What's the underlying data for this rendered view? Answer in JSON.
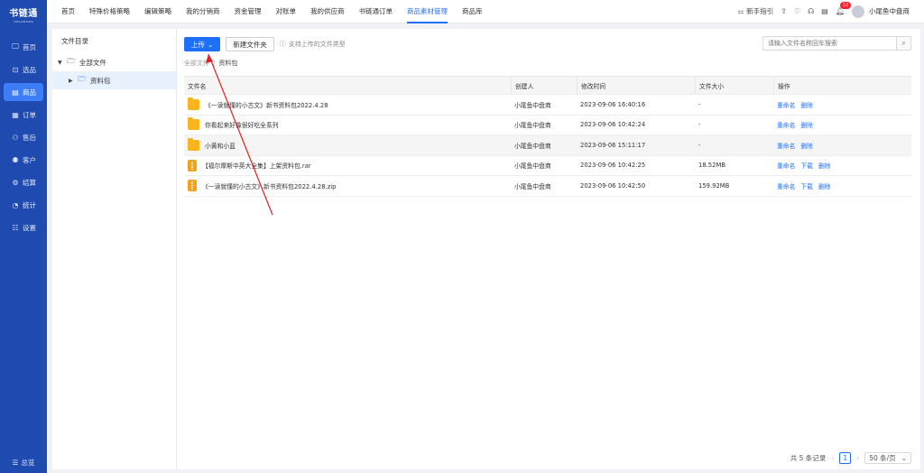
{
  "app": {
    "logo_text": "书链通",
    "logo_sub": "SHULIANTONG"
  },
  "sidebar": {
    "items": [
      {
        "label": "首页",
        "icon": "monitor-icon"
      },
      {
        "label": "选品",
        "icon": "select-icon"
      },
      {
        "label": "商品",
        "icon": "goods-icon",
        "active": true
      },
      {
        "label": "订单",
        "icon": "order-icon"
      },
      {
        "label": "售后",
        "icon": "aftersale-icon"
      },
      {
        "label": "客户",
        "icon": "customer-icon"
      },
      {
        "label": "结算",
        "icon": "settle-icon"
      },
      {
        "label": "统计",
        "icon": "stats-icon"
      },
      {
        "label": "设置",
        "icon": "settings-icon"
      }
    ],
    "collapse_label": "总览"
  },
  "topnav": {
    "tabs": [
      "首页",
      "特殊价格策略",
      "编辑策略",
      "我的分销商",
      "资金管理",
      "对账单",
      "我的供应商",
      "书链通订单",
      "商品素材管理",
      "商品库"
    ],
    "active_tab": "商品素材管理",
    "guide_label": "新手指引",
    "badge_count": "10",
    "user_name": "小尾鱼中盘商"
  },
  "directory": {
    "title": "文件目录",
    "root_label": "全部文件",
    "child_label": "资料包"
  },
  "toolbar": {
    "upload_label": "上传",
    "new_folder_label": "新建文件夹",
    "supported_types_label": "支持上传的文件类型",
    "search_placeholder": "请输入文件名称回车搜索"
  },
  "breadcrumb": {
    "root": "全部文件",
    "separator": "/",
    "current": "资料包"
  },
  "table": {
    "headers": {
      "name": "文件名",
      "creator": "创建人",
      "modified": "修改时间",
      "size": "文件大小",
      "ops": "操作"
    },
    "rows": [
      {
        "type": "folder",
        "name": "《一读就懂的小古文》新书资料包2022.4.28",
        "creator": "小尾鱼中盘商",
        "modified": "2023-09-06 16:40:16",
        "size": "-",
        "ops": [
          "重命名",
          "删除"
        ]
      },
      {
        "type": "folder",
        "name": "你看起来好像很好吃全系列",
        "creator": "小尾鱼中盘商",
        "modified": "2023-09-06 10:42:24",
        "size": "-",
        "ops": [
          "重命名",
          "删除"
        ]
      },
      {
        "type": "folder",
        "name": "小黄和小蓝",
        "creator": "小尾鱼中盘商",
        "modified": "2023-09-06 15:11:17",
        "size": "-",
        "ops": [
          "重命名",
          "删除"
        ]
      },
      {
        "type": "archive",
        "name": "【福尔摩斯中英大全集】上架资料包.rar",
        "creator": "小尾鱼中盘商",
        "modified": "2023-09-06 10:42:25",
        "size": "18.52MB",
        "ops": [
          "重命名",
          "下载",
          "删除"
        ]
      },
      {
        "type": "archive",
        "name": "《一读就懂的小古文》新书资料包2022.4.28.zip",
        "creator": "小尾鱼中盘商",
        "modified": "2023-09-06 10:42:50",
        "size": "159.92MB",
        "ops": [
          "重命名",
          "下载",
          "删除"
        ]
      }
    ]
  },
  "pagination": {
    "total_label": "共 5 条记录",
    "current_page": "1",
    "page_size_label": "50 条/页"
  },
  "annotation": {
    "color": "#e02020"
  }
}
